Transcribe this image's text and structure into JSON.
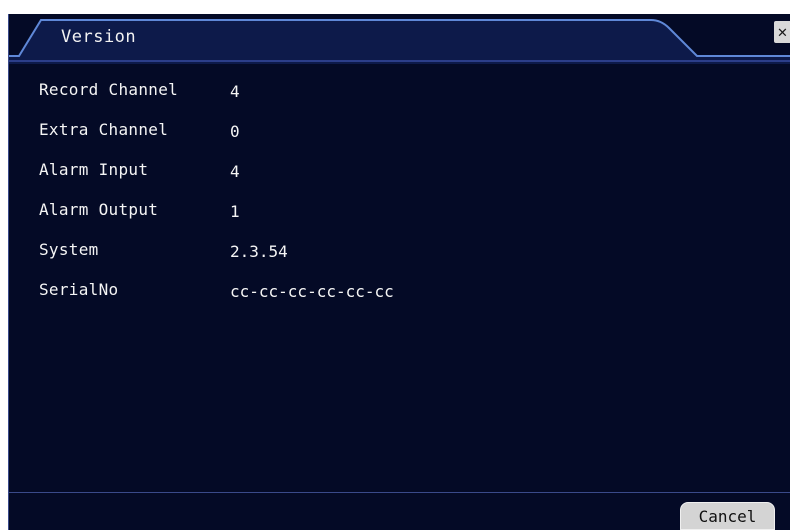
{
  "window": {
    "title": "Version",
    "close_symbol": "✕"
  },
  "info": [
    {
      "label": "Record Channel",
      "value": "4"
    },
    {
      "label": "Extra Channel",
      "value": "0"
    },
    {
      "label": "Alarm Input",
      "value": "4"
    },
    {
      "label": "Alarm Output",
      "value": "1"
    },
    {
      "label": "System",
      "value": "2.3.54"
    },
    {
      "label": "SerialNo",
      "value": "cc-cc-cc-cc-cc-cc"
    }
  ],
  "footer": {
    "cancel_label": "Cancel"
  },
  "colors": {
    "background": "#040a26",
    "title_bar": "#0d1a4a",
    "title_border": "#5f88d8",
    "text": "#f5f5f5"
  },
  "icons": {
    "close": "close-icon"
  }
}
